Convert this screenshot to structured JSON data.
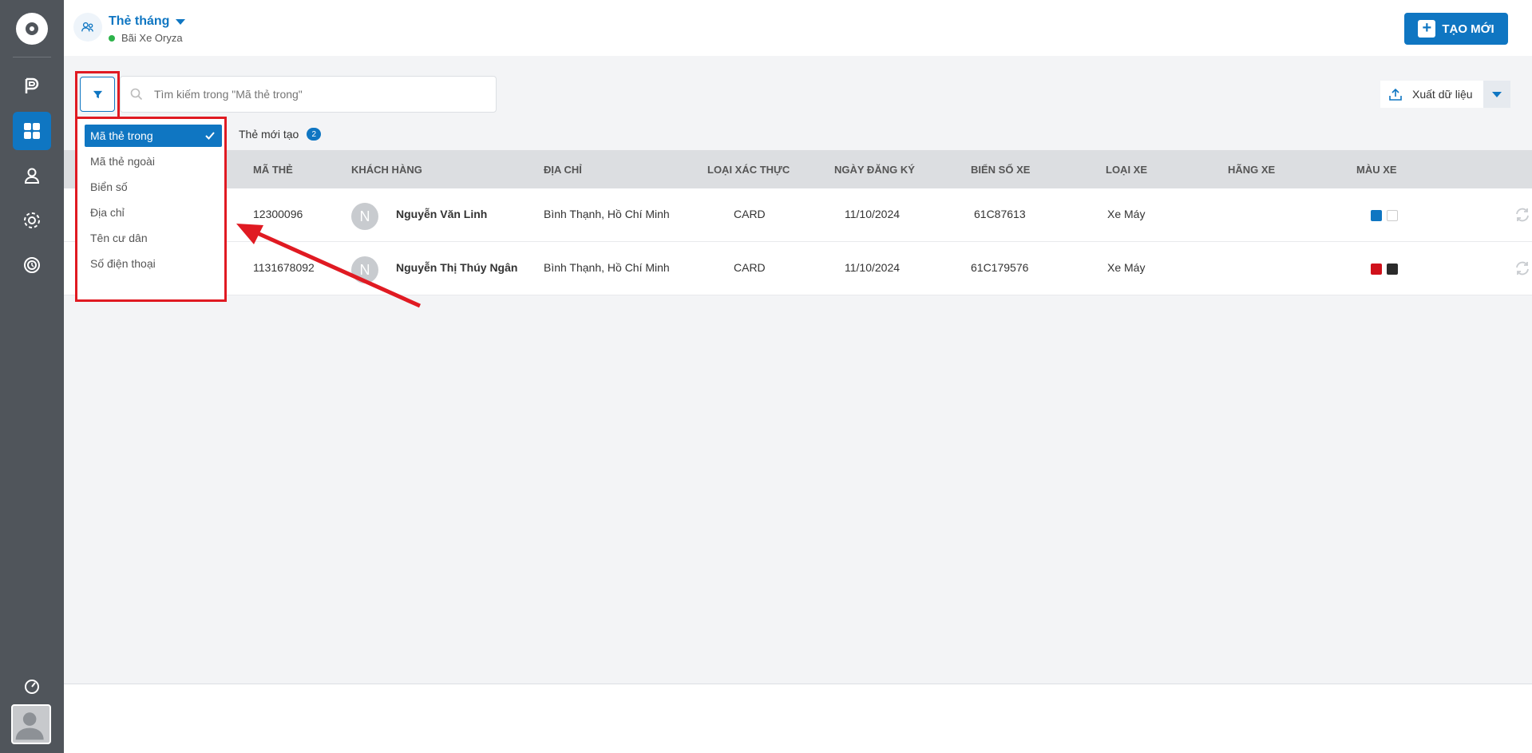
{
  "header": {
    "title": "Thẻ tháng",
    "subtitle": "Bãi Xe Oryza",
    "create_label": "TẠO MỚI",
    "header_icon": "users-icon"
  },
  "sidebar": {
    "items": [
      {
        "name": "parking-icon"
      },
      {
        "name": "dashboard-icon",
        "active": true
      },
      {
        "name": "user-icon"
      },
      {
        "name": "settings-icon"
      },
      {
        "name": "history-icon"
      }
    ],
    "bottom": [
      {
        "name": "speed-icon"
      },
      {
        "name": "avatar"
      }
    ]
  },
  "search": {
    "placeholder": "Tìm kiếm trong \"Mã thẻ trong\""
  },
  "export": {
    "label": "Xuất dữ liệu"
  },
  "tabs": {
    "new_label": "Thẻ mới tạo",
    "new_count": "2"
  },
  "filter_menu": {
    "options": [
      {
        "label": "Mã thẻ trong",
        "selected": true
      },
      {
        "label": "Mã thẻ ngoài",
        "selected": false
      },
      {
        "label": "Biển số",
        "selected": false
      },
      {
        "label": "Địa chỉ",
        "selected": false
      },
      {
        "label": "Tên cư dân",
        "selected": false
      },
      {
        "label": "Số điện thoại",
        "selected": false
      }
    ]
  },
  "table": {
    "headers": [
      "MÃ THẺ",
      "KHÁCH HÀNG",
      "ĐỊA CHỈ",
      "LOẠI XÁC THỰC",
      "NGÀY ĐĂNG KÝ",
      "BIỂN SỐ XE",
      "LOẠI XE",
      "HÃNG XE",
      "MÀU XE"
    ],
    "rows": [
      {
        "ma_the": "12300096",
        "avatar": "N",
        "khach_hang": "Nguyễn Văn Linh",
        "dia_chi": "Bình Thạnh, Hồ Chí Minh",
        "loai_xac_thuc": "CARD",
        "ngay_dang_ky": "11/10/2024",
        "bien_so": "61C87613",
        "loai_xe": "Xe Máy",
        "hang_xe": "",
        "mau_xe": [
          "#0f76c2",
          "#ffffff"
        ]
      },
      {
        "ma_the": "1131678092",
        "avatar": "N",
        "khach_hang": "Nguyễn Thị Thúy Ngân",
        "dia_chi": "Bình Thạnh, Hồ Chí Minh",
        "loai_xac_thuc": "CARD",
        "ngay_dang_ky": "11/10/2024",
        "bien_so": "61C179576",
        "loai_xe": "Xe Máy",
        "hang_xe": "",
        "mau_xe": [
          "#d0111b",
          "#2b2b2b"
        ]
      }
    ]
  },
  "colors": {
    "primary": "#0f76c2",
    "sidebar": "#50555b",
    "highlight": "#e01a22",
    "status_online": "#2db34a"
  }
}
